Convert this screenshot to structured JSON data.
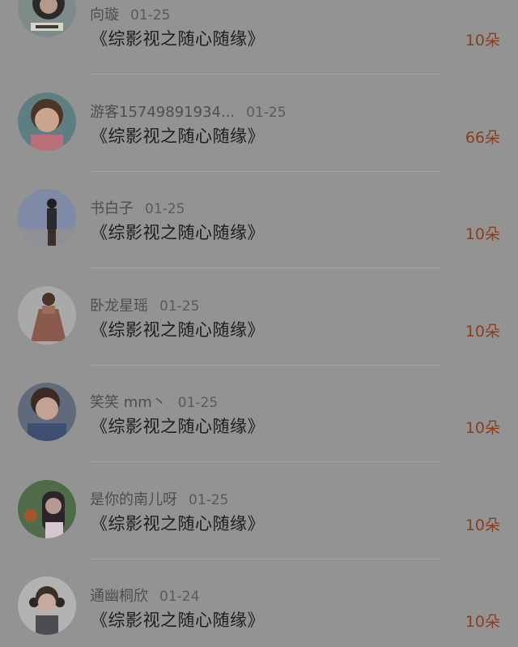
{
  "gift_list": [
    {
      "username": "向璇",
      "date": "01-25",
      "title": "《综影视之随心随缘》",
      "amount": "10朵",
      "avatar": "avatar-girl-dark-hair-icon"
    },
    {
      "username": "游客15749891934...",
      "date": "01-25",
      "title": "《综影视之随心随缘》",
      "amount": "66朵",
      "avatar": "avatar-child-icon"
    },
    {
      "username": "书白子",
      "date": "01-25",
      "title": "《综影视之随心随缘》",
      "amount": "10朵",
      "avatar": "avatar-person-backlit-icon"
    },
    {
      "username": "卧龙星瑶",
      "date": "01-25",
      "title": "《综影视之随心随缘》",
      "amount": "10朵",
      "avatar": "avatar-girl-dress-icon"
    },
    {
      "username": "笑笑 mm丶",
      "date": "01-25",
      "title": "《综影视之随心随缘》",
      "amount": "10朵",
      "avatar": "avatar-child-smile-icon"
    },
    {
      "username": "是你的南儿呀",
      "date": "01-25",
      "title": "《综影视之随心随缘》",
      "amount": "10朵",
      "avatar": "avatar-girl-long-hair-icon"
    },
    {
      "username": "通幽桐欣",
      "date": "01-24",
      "title": "《综影视之随心随缘》",
      "amount": "10朵",
      "avatar": "avatar-girl-pigtails-icon"
    }
  ],
  "colors": {
    "overlay": "#939393",
    "amount": "#8a3f1c"
  }
}
